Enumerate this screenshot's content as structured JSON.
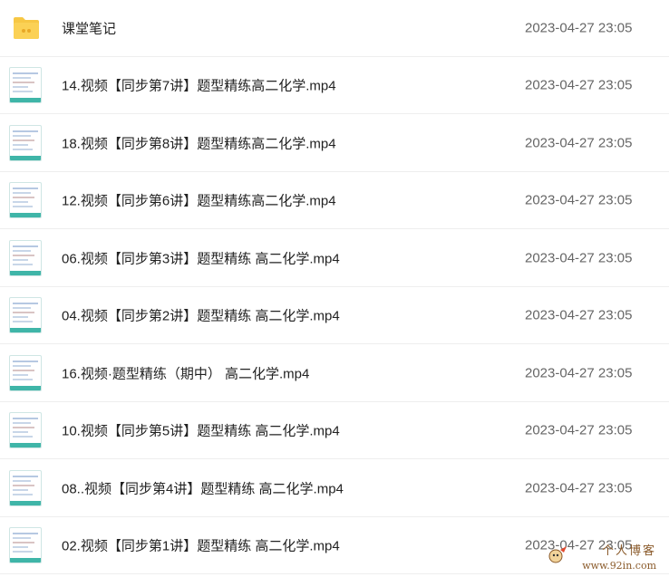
{
  "rows": [
    {
      "type": "folder",
      "name": "课堂笔记",
      "date": "2023-04-27 23:05"
    },
    {
      "type": "video",
      "name": "14.视频【同步第7讲】题型精练高二化学.mp4",
      "date": "2023-04-27 23:05"
    },
    {
      "type": "video",
      "name": "18.视频【同步第8讲】题型精练高二化学.mp4",
      "date": "2023-04-27 23:05"
    },
    {
      "type": "video",
      "name": "12.视频【同步第6讲】题型精练高二化学.mp4",
      "date": "2023-04-27 23:05"
    },
    {
      "type": "video",
      "name": "06.视频【同步第3讲】题型精练 高二化学.mp4",
      "date": "2023-04-27 23:05"
    },
    {
      "type": "video",
      "name": "04.视频【同步第2讲】题型精练 高二化学.mp4",
      "date": "2023-04-27 23:05"
    },
    {
      "type": "video",
      "name": "16.视频·题型精练（期中） 高二化学.mp4",
      "date": "2023-04-27 23:05"
    },
    {
      "type": "video",
      "name": "10.视频【同步第5讲】题型精练 高二化学.mp4",
      "date": "2023-04-27 23:05"
    },
    {
      "type": "video",
      "name": "08..视频【同步第4讲】题型精练 高二化学.mp4",
      "date": "2023-04-27 23:05"
    },
    {
      "type": "video",
      "name": "02.视频【同步第1讲】题型精练 高二化学.mp4",
      "date": "2023-04-27 23:05"
    }
  ],
  "colors": {
    "folder": "#f7c744",
    "thumb_accent": "#3fb5a8"
  },
  "watermark": {
    "title": "个人博客",
    "url": "www.92in.com"
  }
}
